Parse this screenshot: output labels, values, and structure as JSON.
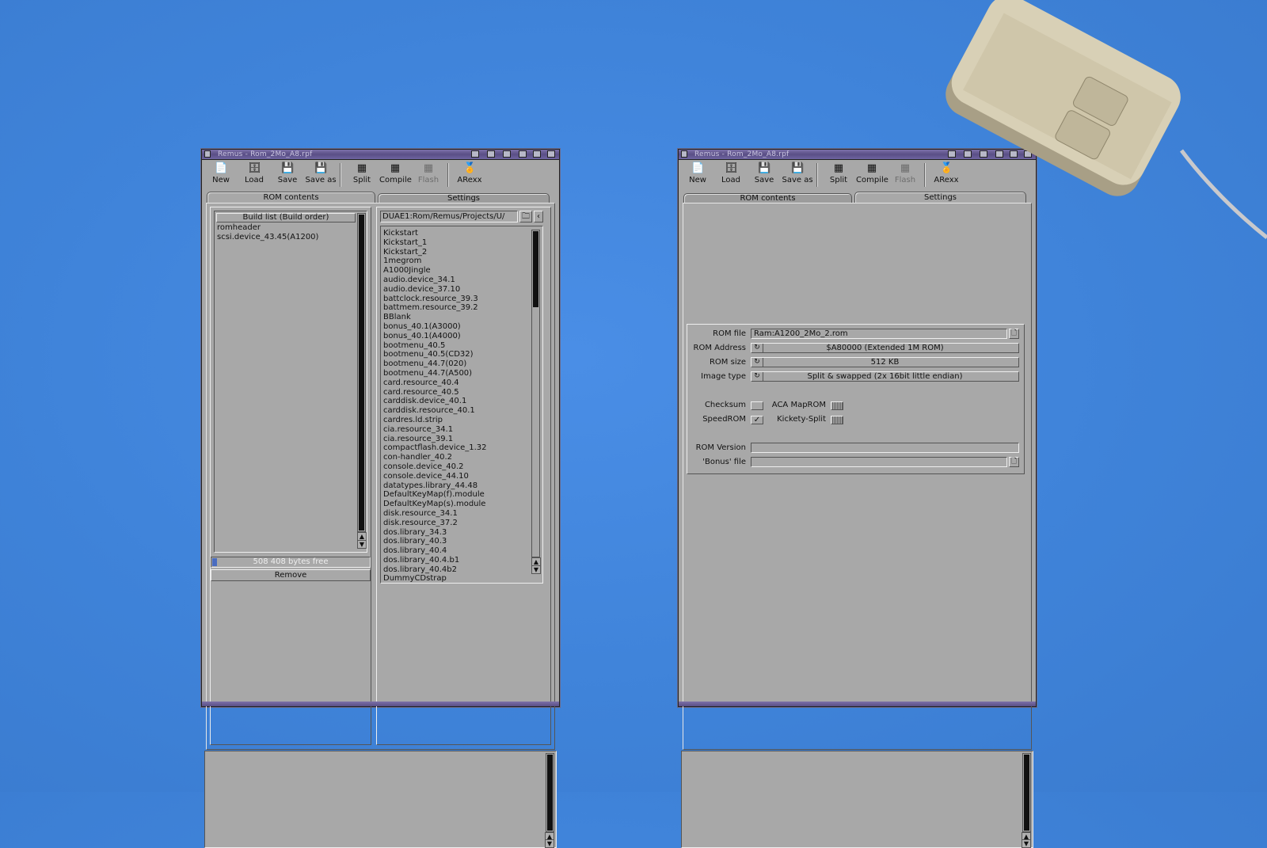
{
  "window_title": "Remus - Rom_2Mo_A8.rpf",
  "toolbar": [
    {
      "label": "New",
      "icon": "new-document-icon",
      "disabled": false
    },
    {
      "label": "Load",
      "icon": "load-drawer-icon",
      "disabled": false
    },
    {
      "label": "Save",
      "icon": "floppy-disk-icon",
      "disabled": false
    },
    {
      "label": "Save as",
      "icon": "floppy-save-as-icon",
      "disabled": false
    },
    {
      "label": "Split",
      "icon": "chip-split-icon",
      "disabled": false
    },
    {
      "label": "Compile",
      "icon": "chip-compile-icon",
      "disabled": false
    },
    {
      "label": "Flash",
      "icon": "chip-flash-icon",
      "disabled": true
    },
    {
      "label": "ARexx",
      "icon": "arexx-icon",
      "disabled": false
    }
  ],
  "tabs": [
    "ROM contents",
    "Settings"
  ],
  "rom_contents": {
    "build_list_header": "Build list (Build order)",
    "build_list": [
      "romheader",
      "scsi.device_43.45(A1200)"
    ],
    "bytes_free": "508 408 bytes free",
    "remove_button": "Remove",
    "path": "DUAE1:Rom/Remus/Projects/U/",
    "modules": [
      "Kickstart",
      "Kickstart_1",
      "Kickstart_2",
      "1megrom",
      "A1000Jingle",
      "audio.device_34.1",
      "audio.device_37.10",
      "battclock.resource_39.3",
      "battmem.resource_39.2",
      "BBlank",
      "bonus_40.1(A3000)",
      "bonus_40.1(A4000)",
      "bootmenu_40.5",
      "bootmenu_40.5(CD32)",
      "bootmenu_44.7(020)",
      "bootmenu_44.7(A500)",
      "card.resource_40.4",
      "card.resource_40.5",
      "carddisk.device_40.1",
      "carddisk.resource_40.1",
      "cardres.ld.strip",
      "cia.resource_34.1",
      "cia.resource_39.1",
      "compactflash.device_1.32",
      "con-handler_40.2",
      "console.device_40.2",
      "console.device_44.10",
      "datatypes.library_44.48",
      "DefaultKeyMap(f).module",
      "DefaultKeyMap(s).module",
      "disk.resource_34.1",
      "disk.resource_37.2",
      "dos.library_34.3",
      "dos.library_40.3",
      "dos.library_40.4",
      "dos.library_40.4.b1",
      "dos.library_40.4b2",
      "DummyCDstrap"
    ]
  },
  "settings": {
    "rom_file_label": "ROM file",
    "rom_file_value": "Ram:A1200_2Mo_2.rom",
    "rom_address_label": "ROM Address",
    "rom_address_value": "$A80000 (Extended 1M ROM)",
    "rom_size_label": "ROM size",
    "rom_size_value": "512 KB",
    "image_type_label": "Image type",
    "image_type_value": "Split & swapped (2x 16bit little endian)",
    "checksum_label": "Checksum",
    "aca_maprom_label": "ACA MapROM",
    "speedrom_label": "SpeedROM",
    "kickety_split_label": "Kickety-Split",
    "rom_version_label": "ROM Version",
    "bonus_file_label": "'Bonus' file"
  },
  "colors": {
    "desktop": "#3f83d9",
    "window_bg": "#a8a8a8",
    "titlebar": "#5a4f86"
  }
}
